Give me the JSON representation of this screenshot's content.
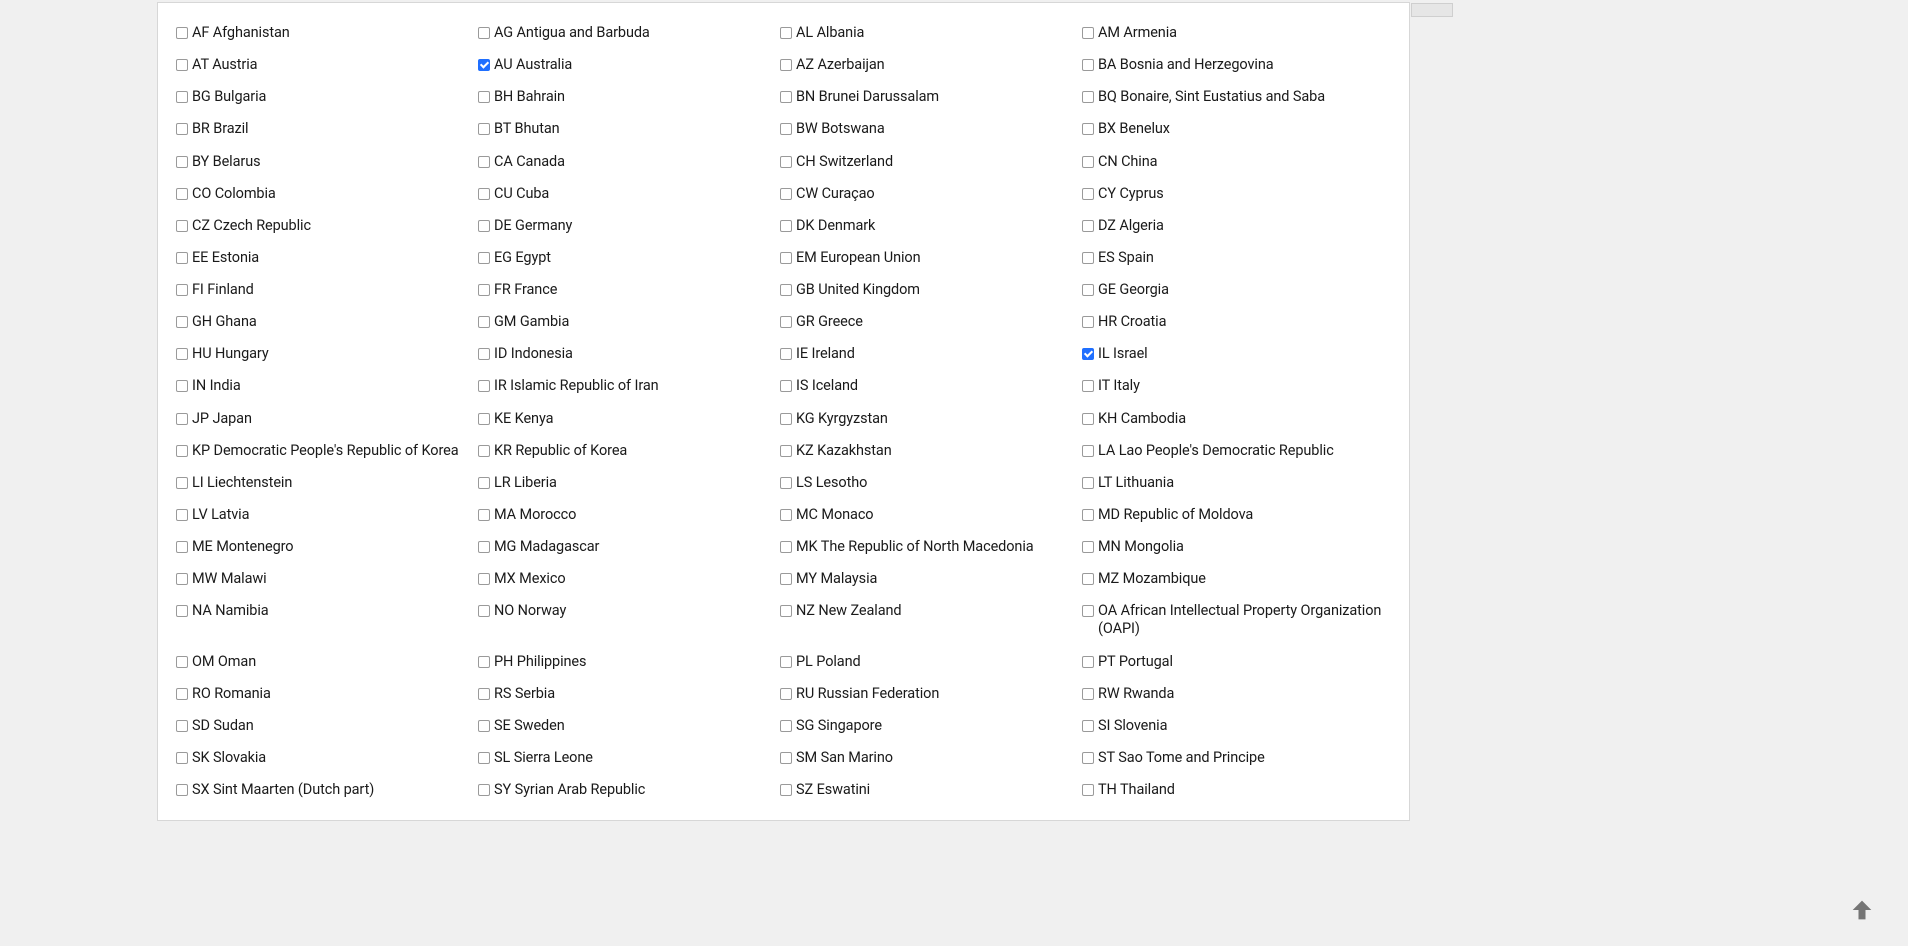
{
  "countries": [
    [
      {
        "label": "AF Afghanistan",
        "checked": false
      },
      {
        "label": "AG Antigua and Barbuda",
        "checked": false
      },
      {
        "label": "AL Albania",
        "checked": false
      },
      {
        "label": "AM Armenia",
        "checked": false
      }
    ],
    [
      {
        "label": "AT Austria",
        "checked": false
      },
      {
        "label": "AU Australia",
        "checked": true
      },
      {
        "label": "AZ Azerbaijan",
        "checked": false
      },
      {
        "label": "BA Bosnia and Herzegovina",
        "checked": false
      }
    ],
    [
      {
        "label": "BG Bulgaria",
        "checked": false
      },
      {
        "label": "BH Bahrain",
        "checked": false
      },
      {
        "label": "BN Brunei Darussalam",
        "checked": false
      },
      {
        "label": "BQ Bonaire, Sint Eustatius and Saba",
        "checked": false
      }
    ],
    [
      {
        "label": "BR Brazil",
        "checked": false
      },
      {
        "label": "BT Bhutan",
        "checked": false
      },
      {
        "label": "BW Botswana",
        "checked": false
      },
      {
        "label": "BX Benelux",
        "checked": false
      }
    ],
    [
      {
        "label": "BY Belarus",
        "checked": false
      },
      {
        "label": "CA Canada",
        "checked": false
      },
      {
        "label": "CH Switzerland",
        "checked": false
      },
      {
        "label": "CN China",
        "checked": false
      }
    ],
    [
      {
        "label": "CO Colombia",
        "checked": false
      },
      {
        "label": "CU Cuba",
        "checked": false
      },
      {
        "label": "CW Curaçao",
        "checked": false
      },
      {
        "label": "CY Cyprus",
        "checked": false
      }
    ],
    [
      {
        "label": "CZ Czech Republic",
        "checked": false
      },
      {
        "label": "DE Germany",
        "checked": false
      },
      {
        "label": "DK Denmark",
        "checked": false
      },
      {
        "label": "DZ Algeria",
        "checked": false
      }
    ],
    [
      {
        "label": "EE Estonia",
        "checked": false
      },
      {
        "label": "EG Egypt",
        "checked": false
      },
      {
        "label": "EM European Union",
        "checked": false
      },
      {
        "label": "ES Spain",
        "checked": false
      }
    ],
    [
      {
        "label": "FI Finland",
        "checked": false
      },
      {
        "label": "FR France",
        "checked": false
      },
      {
        "label": "GB United Kingdom",
        "checked": false
      },
      {
        "label": "GE Georgia",
        "checked": false
      }
    ],
    [
      {
        "label": "GH Ghana",
        "checked": false
      },
      {
        "label": "GM Gambia",
        "checked": false
      },
      {
        "label": "GR Greece",
        "checked": false
      },
      {
        "label": "HR Croatia",
        "checked": false
      }
    ],
    [
      {
        "label": "HU Hungary",
        "checked": false
      },
      {
        "label": "ID Indonesia",
        "checked": false
      },
      {
        "label": "IE Ireland",
        "checked": false
      },
      {
        "label": "IL Israel",
        "checked": true
      }
    ],
    [
      {
        "label": "IN India",
        "checked": false
      },
      {
        "label": "IR Islamic Republic of Iran",
        "checked": false
      },
      {
        "label": "IS Iceland",
        "checked": false
      },
      {
        "label": "IT Italy",
        "checked": false
      }
    ],
    [
      {
        "label": "JP Japan",
        "checked": false
      },
      {
        "label": "KE Kenya",
        "checked": false
      },
      {
        "label": "KG Kyrgyzstan",
        "checked": false
      },
      {
        "label": "KH Cambodia",
        "checked": false
      }
    ],
    [
      {
        "label": "KP Democratic People's Republic of Korea",
        "checked": false
      },
      {
        "label": "KR Republic of Korea",
        "checked": false
      },
      {
        "label": "KZ Kazakhstan",
        "checked": false
      },
      {
        "label": "LA Lao People's Democratic Republic",
        "checked": false
      }
    ],
    [
      {
        "label": "LI Liechtenstein",
        "checked": false
      },
      {
        "label": "LR Liberia",
        "checked": false
      },
      {
        "label": "LS Lesotho",
        "checked": false
      },
      {
        "label": "LT Lithuania",
        "checked": false
      }
    ],
    [
      {
        "label": "LV Latvia",
        "checked": false
      },
      {
        "label": "MA Morocco",
        "checked": false
      },
      {
        "label": "MC Monaco",
        "checked": false
      },
      {
        "label": "MD Republic of Moldova",
        "checked": false
      }
    ],
    [
      {
        "label": "ME Montenegro",
        "checked": false
      },
      {
        "label": "MG Madagascar",
        "checked": false
      },
      {
        "label": "MK The Republic of North Macedonia",
        "checked": false
      },
      {
        "label": "MN Mongolia",
        "checked": false
      }
    ],
    [
      {
        "label": "MW Malawi",
        "checked": false
      },
      {
        "label": "MX Mexico",
        "checked": false
      },
      {
        "label": "MY Malaysia",
        "checked": false
      },
      {
        "label": "MZ Mozambique",
        "checked": false
      }
    ],
    [
      {
        "label": "NA Namibia",
        "checked": false
      },
      {
        "label": "NO Norway",
        "checked": false
      },
      {
        "label": "NZ New Zealand",
        "checked": false
      },
      {
        "label": "OA African Intellectual Property Organization (OAPI)",
        "checked": false
      }
    ],
    [
      {
        "label": "OM Oman",
        "checked": false
      },
      {
        "label": "PH Philippines",
        "checked": false
      },
      {
        "label": "PL Poland",
        "checked": false
      },
      {
        "label": "PT Portugal",
        "checked": false
      }
    ],
    [
      {
        "label": "RO Romania",
        "checked": false
      },
      {
        "label": "RS Serbia",
        "checked": false
      },
      {
        "label": "RU Russian Federation",
        "checked": false
      },
      {
        "label": "RW Rwanda",
        "checked": false
      }
    ],
    [
      {
        "label": "SD Sudan",
        "checked": false
      },
      {
        "label": "SE Sweden",
        "checked": false
      },
      {
        "label": "SG Singapore",
        "checked": false
      },
      {
        "label": "SI Slovenia",
        "checked": false
      }
    ],
    [
      {
        "label": "SK Slovakia",
        "checked": false
      },
      {
        "label": "SL Sierra Leone",
        "checked": false
      },
      {
        "label": "SM San Marino",
        "checked": false
      },
      {
        "label": "ST Sao Tome and Principe",
        "checked": false
      }
    ],
    [
      {
        "label": "SX Sint Maarten (Dutch part)",
        "checked": false
      },
      {
        "label": "SY Syrian Arab Republic",
        "checked": false
      },
      {
        "label": "SZ Eswatini",
        "checked": false
      },
      {
        "label": "TH Thailand",
        "checked": false
      }
    ]
  ]
}
